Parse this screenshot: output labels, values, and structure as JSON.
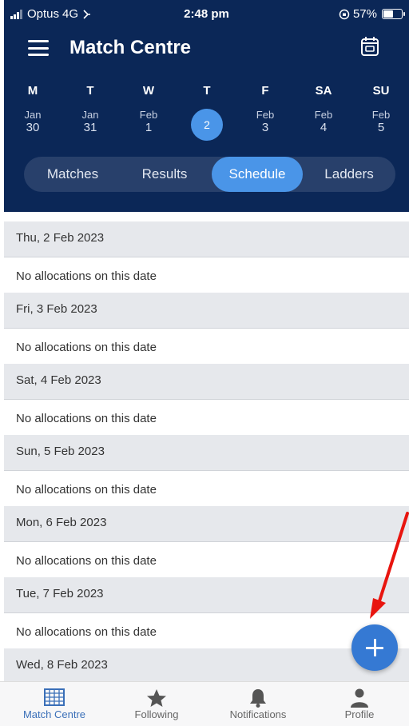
{
  "status_bar": {
    "carrier": "Optus",
    "network": "4G",
    "time": "2:48 pm",
    "battery": "57%",
    "battery_level": 0.57
  },
  "header": {
    "title": "Match Centre",
    "menu_icon": "hamburger-icon",
    "calendar_icon": "calendar-icon"
  },
  "days": [
    {
      "letter": "M",
      "month": "Jan",
      "day": "30"
    },
    {
      "letter": "T",
      "month": "Jan",
      "day": "31"
    },
    {
      "letter": "W",
      "month": "Feb",
      "day": "1"
    },
    {
      "letter": "T",
      "month": "",
      "day": "2",
      "selected": true
    },
    {
      "letter": "F",
      "month": "Feb",
      "day": "3"
    },
    {
      "letter": "SA",
      "month": "Feb",
      "day": "4"
    },
    {
      "letter": "SU",
      "month": "Feb",
      "day": "5"
    }
  ],
  "tabs": [
    {
      "label": "Matches"
    },
    {
      "label": "Results"
    },
    {
      "label": "Schedule",
      "active": true
    },
    {
      "label": "Ladders"
    }
  ],
  "schedule": [
    {
      "date": "Thu, 2 Feb 2023",
      "message": "No allocations on this date"
    },
    {
      "date": "Fri, 3 Feb 2023",
      "message": "No allocations on this date"
    },
    {
      "date": "Sat, 4 Feb 2023",
      "message": "No allocations on this date"
    },
    {
      "date": "Sun, 5 Feb 2023",
      "message": "No allocations on this date"
    },
    {
      "date": "Mon, 6 Feb 2023",
      "message": "No allocations on this date"
    },
    {
      "date": "Tue, 7 Feb 2023",
      "message": "No allocations on this date"
    },
    {
      "date": "Wed, 8 Feb 2023",
      "message": ""
    }
  ],
  "fab": {
    "icon": "plus-icon"
  },
  "bottom_nav": [
    {
      "label": "Match Centre",
      "icon": "grid-icon",
      "active": true
    },
    {
      "label": "Following",
      "icon": "star-icon"
    },
    {
      "label": "Notifications",
      "icon": "bell-icon"
    },
    {
      "label": "Profile",
      "icon": "person-icon"
    }
  ],
  "colors": {
    "header_bg": "#0b2757",
    "accent": "#4a95e8",
    "fab": "#3579d3",
    "annotation": "#e8150f"
  }
}
